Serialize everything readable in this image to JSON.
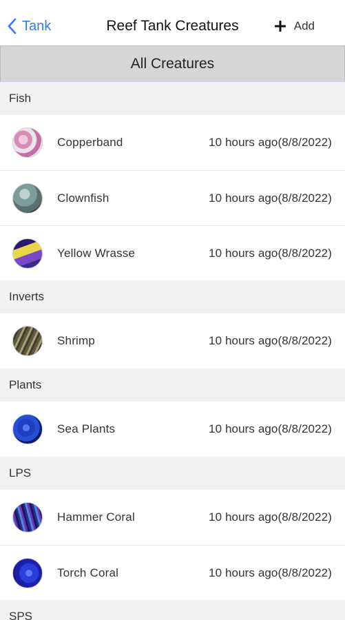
{
  "nav": {
    "back_label": "Tank",
    "title": "Reef Tank Creatures",
    "add_label": "Add"
  },
  "segment": {
    "label": "All Creatures"
  },
  "sections": [
    {
      "title": "Fish",
      "rows": [
        {
          "name": "Copperband",
          "time": "10 hours ago(8/8/2022)",
          "thumb": "t0"
        },
        {
          "name": "Clownfish",
          "time": "10 hours ago(8/8/2022)",
          "thumb": "t1"
        },
        {
          "name": "Yellow Wrasse",
          "time": "10 hours ago(8/8/2022)",
          "thumb": "t2"
        }
      ]
    },
    {
      "title": "Inverts",
      "rows": [
        {
          "name": "Shrimp",
          "time": "10 hours ago(8/8/2022)",
          "thumb": "t3"
        }
      ]
    },
    {
      "title": "Plants",
      "rows": [
        {
          "name": "Sea Plants",
          "time": "10 hours ago(8/8/2022)",
          "thumb": "t4"
        }
      ]
    },
    {
      "title": "LPS",
      "rows": [
        {
          "name": "Hammer Coral",
          "time": "10 hours ago(8/8/2022)",
          "thumb": "t5"
        },
        {
          "name": "Torch Coral",
          "time": "10 hours ago(8/8/2022)",
          "thumb": "t6"
        }
      ]
    },
    {
      "title": "SPS",
      "rows": []
    }
  ],
  "icons": {
    "back": "chevron-left-icon",
    "add": "plus-icon"
  },
  "colors": {
    "accent": "#2f7cf6",
    "section_bg": "#f1f1f1",
    "segment_bg": "#d6d6d6"
  }
}
